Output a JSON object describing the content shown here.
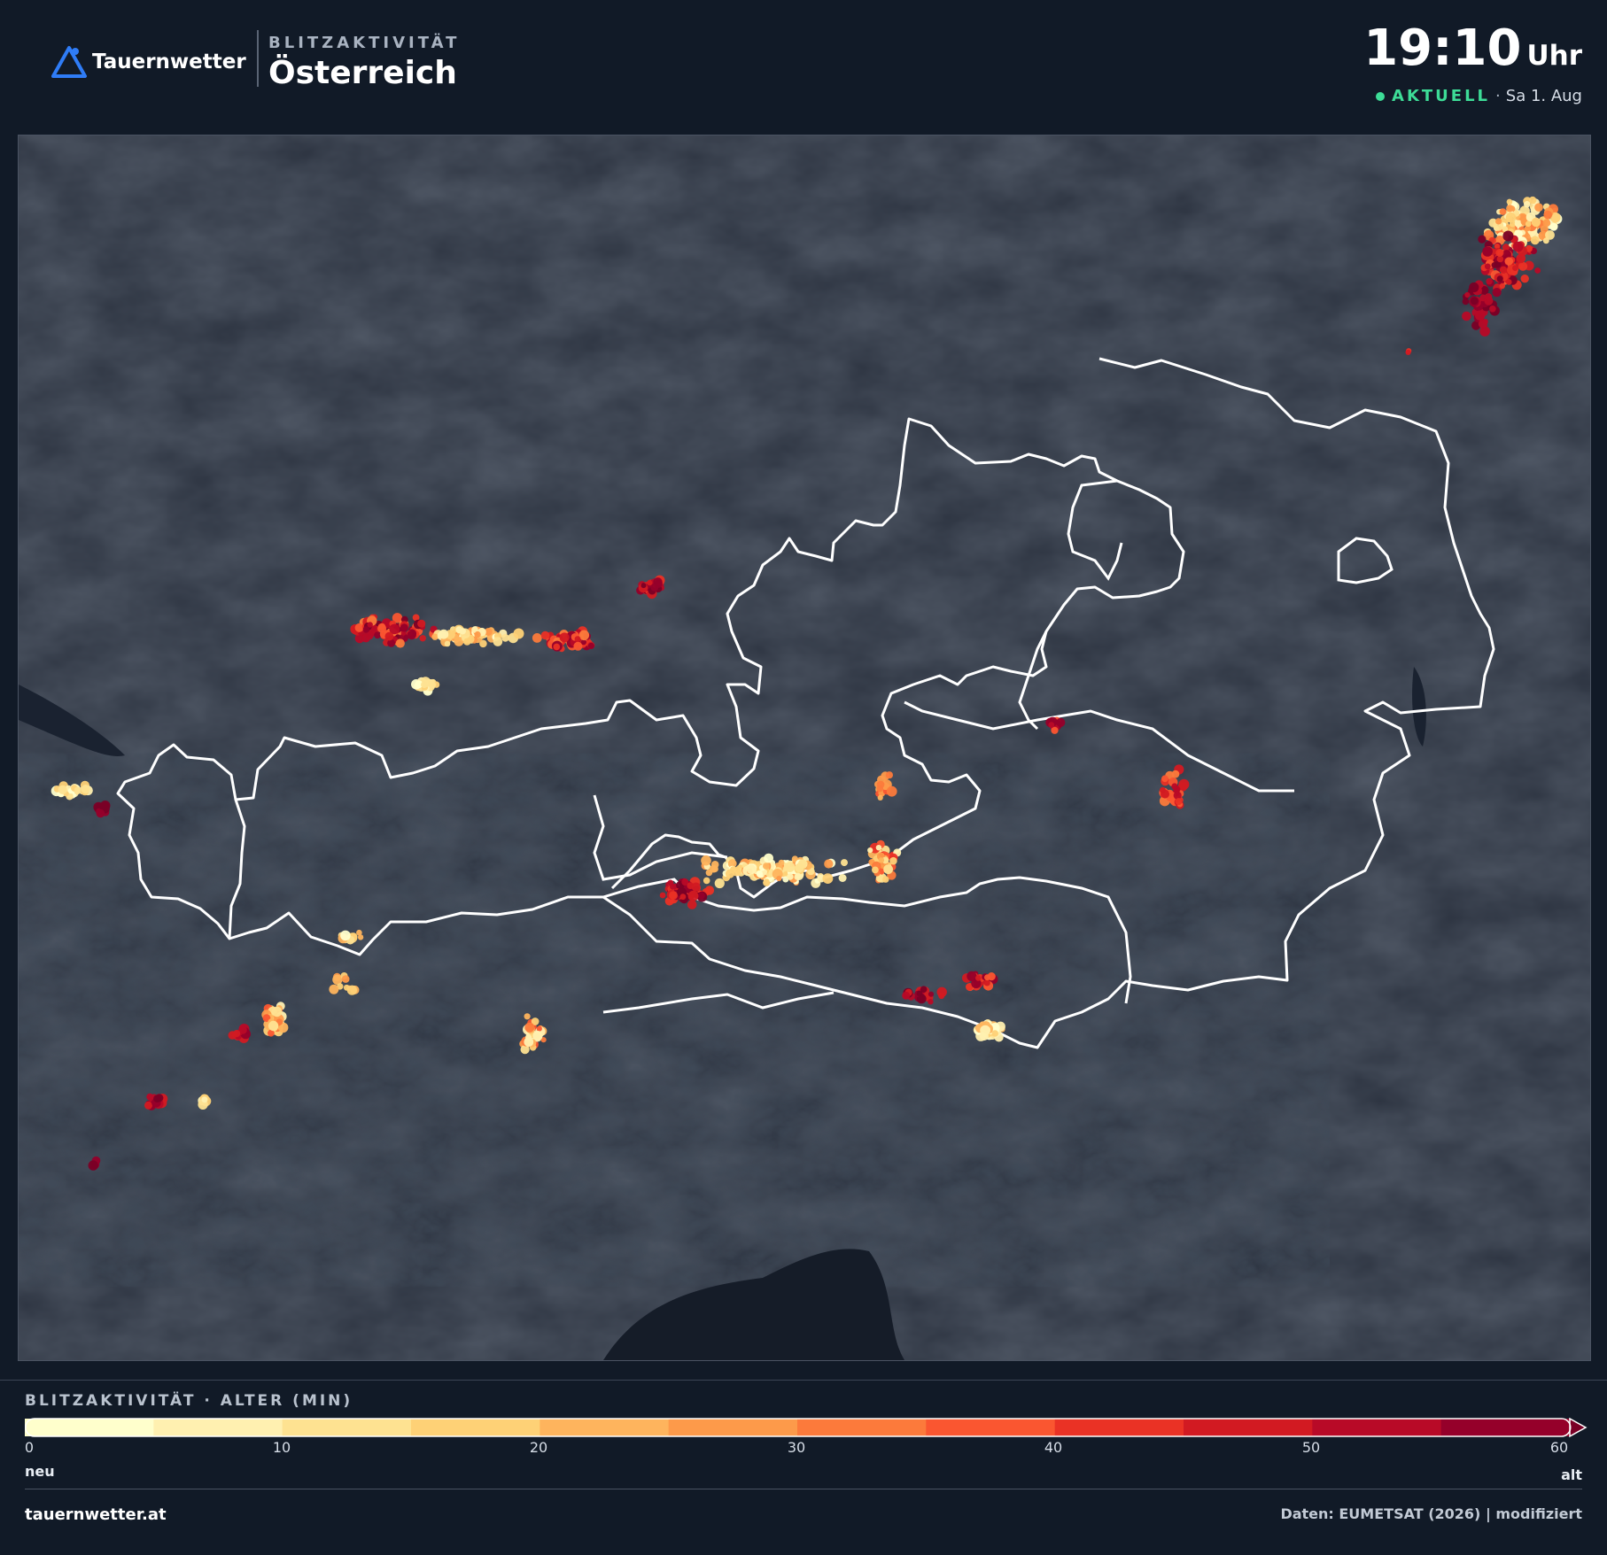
{
  "header": {
    "brand": "Tauernwetter",
    "subtitle": "BLITZAKTIVITÄT",
    "title": "Österreich",
    "time": "19:10",
    "time_unit": "Uhr",
    "status": "AKTUELL",
    "separator": "·",
    "date": "Sa 1. Aug"
  },
  "legend": {
    "title": "BLITZAKTIVITÄT · ALTER (MIN)",
    "ticks": [
      "0",
      "10",
      "20",
      "30",
      "40",
      "50",
      "60"
    ],
    "low_label": "neu",
    "high_label": "alt",
    "colors": [
      "#ffffcc",
      "#fff0b0",
      "#fee291",
      "#fed176",
      "#feb45d",
      "#fd9a4a",
      "#fc7a3b",
      "#fa5630",
      "#ea3225",
      "#d21a22",
      "#b80a27",
      "#95002a",
      "#7a0026"
    ]
  },
  "footer": {
    "site": "tauernwetter.at",
    "credits": "Daten: EUMETSAT (2026) | modifiziert"
  },
  "colors": {
    "background": "#111a27",
    "map_base": "#2a313e",
    "status_green": "#3ddc97",
    "border_white": "#ffffff"
  }
}
